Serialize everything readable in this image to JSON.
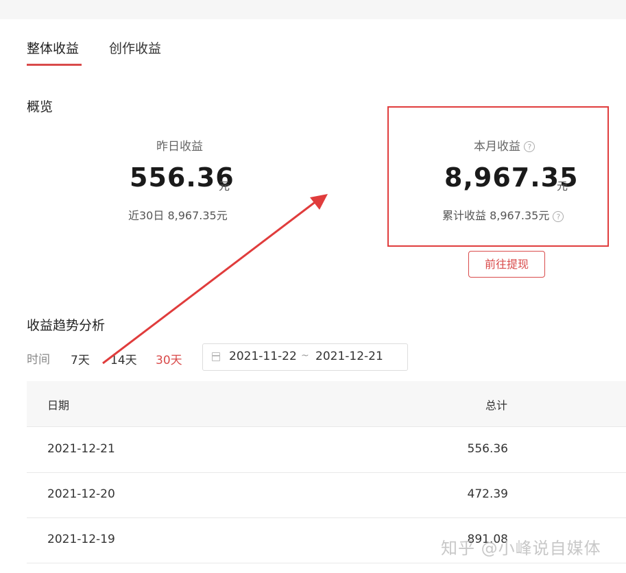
{
  "tabs": [
    {
      "label": "整体收益",
      "active": true
    },
    {
      "label": "创作收益",
      "active": false
    }
  ],
  "overview": {
    "title": "概览",
    "yesterday": {
      "label": "昨日收益",
      "value": "556.36",
      "unit": "元",
      "sub": "近30日 8,967.35元"
    },
    "month": {
      "label": "本月收益",
      "value": "8,967.35",
      "unit": "元",
      "sub": "累计收益 8,967.35元"
    },
    "withdraw_label": "前往提现",
    "help_glyph": "?"
  },
  "trend": {
    "title": "收益趋势分析",
    "time_label": "时间",
    "ranges": [
      "7天",
      "14天",
      "30天"
    ],
    "active_range": "30天",
    "date_start": "2021-11-22",
    "date_sep": "~",
    "date_end": "2021-12-21"
  },
  "table": {
    "columns": [
      "日期",
      "总计"
    ],
    "rows": [
      {
        "date": "2021-12-21",
        "total": "556.36"
      },
      {
        "date": "2021-12-20",
        "total": "472.39"
      },
      {
        "date": "2021-12-19",
        "total": "891.08"
      }
    ]
  },
  "watermark": "知乎 @小峰说自媒体",
  "colors": {
    "accent": "#d94a4a",
    "highlight_box": "#e03c3c",
    "arrow": "#e03c3c"
  }
}
